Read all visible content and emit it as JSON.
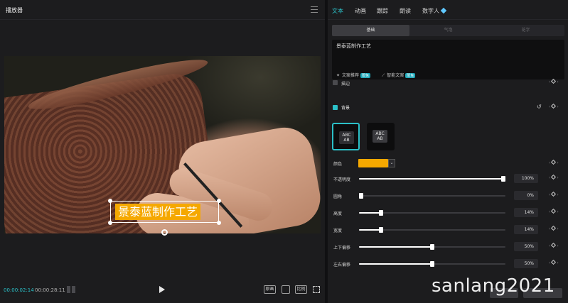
{
  "player": {
    "title": "播放器",
    "caption_text": "景泰蓝制作工艺",
    "time_current": "00:00:02:14",
    "time_total": "00:00:28:11",
    "buttons": [
      "原画",
      "比例"
    ]
  },
  "inspector": {
    "tabs": [
      {
        "label": "文本",
        "active": true
      },
      {
        "label": "动画",
        "active": false
      },
      {
        "label": "跟踪",
        "active": false
      },
      {
        "label": "朗读",
        "active": false
      },
      {
        "label": "数字人",
        "active": false
      }
    ],
    "subtabs": [
      {
        "label": "基础",
        "active": true
      },
      {
        "label": "气泡",
        "active": false
      },
      {
        "label": "花字",
        "active": false
      }
    ],
    "text_value": "景泰蓝制作工艺",
    "ai_recommend": "文案推荐",
    "ai_smart": "智能文案",
    "badge": "限免",
    "stroke_label": "描边",
    "background_label": "背景",
    "presets": [
      "ABC\nAB",
      "ABC\nAB"
    ],
    "color_label": "颜色",
    "color_value": "#f5a800",
    "sliders": [
      {
        "label": "不透明度",
        "value": "100%",
        "fraction": 1.0
      },
      {
        "label": "圆角",
        "value": "0%",
        "fraction": 0.0
      },
      {
        "label": "高度",
        "value": "14%",
        "fraction": 0.14
      },
      {
        "label": "宽度",
        "value": "14%",
        "fraction": 0.14
      },
      {
        "label": "上下偏移",
        "value": "50%",
        "fraction": 0.5
      },
      {
        "label": "左右偏移",
        "value": "50%",
        "fraction": 0.5
      }
    ]
  },
  "watermark": "sanlang2021",
  "colors": {
    "accent": "#2bc0c8",
    "caption_bg": "#f5a800",
    "panel": "#1c1c1e"
  }
}
